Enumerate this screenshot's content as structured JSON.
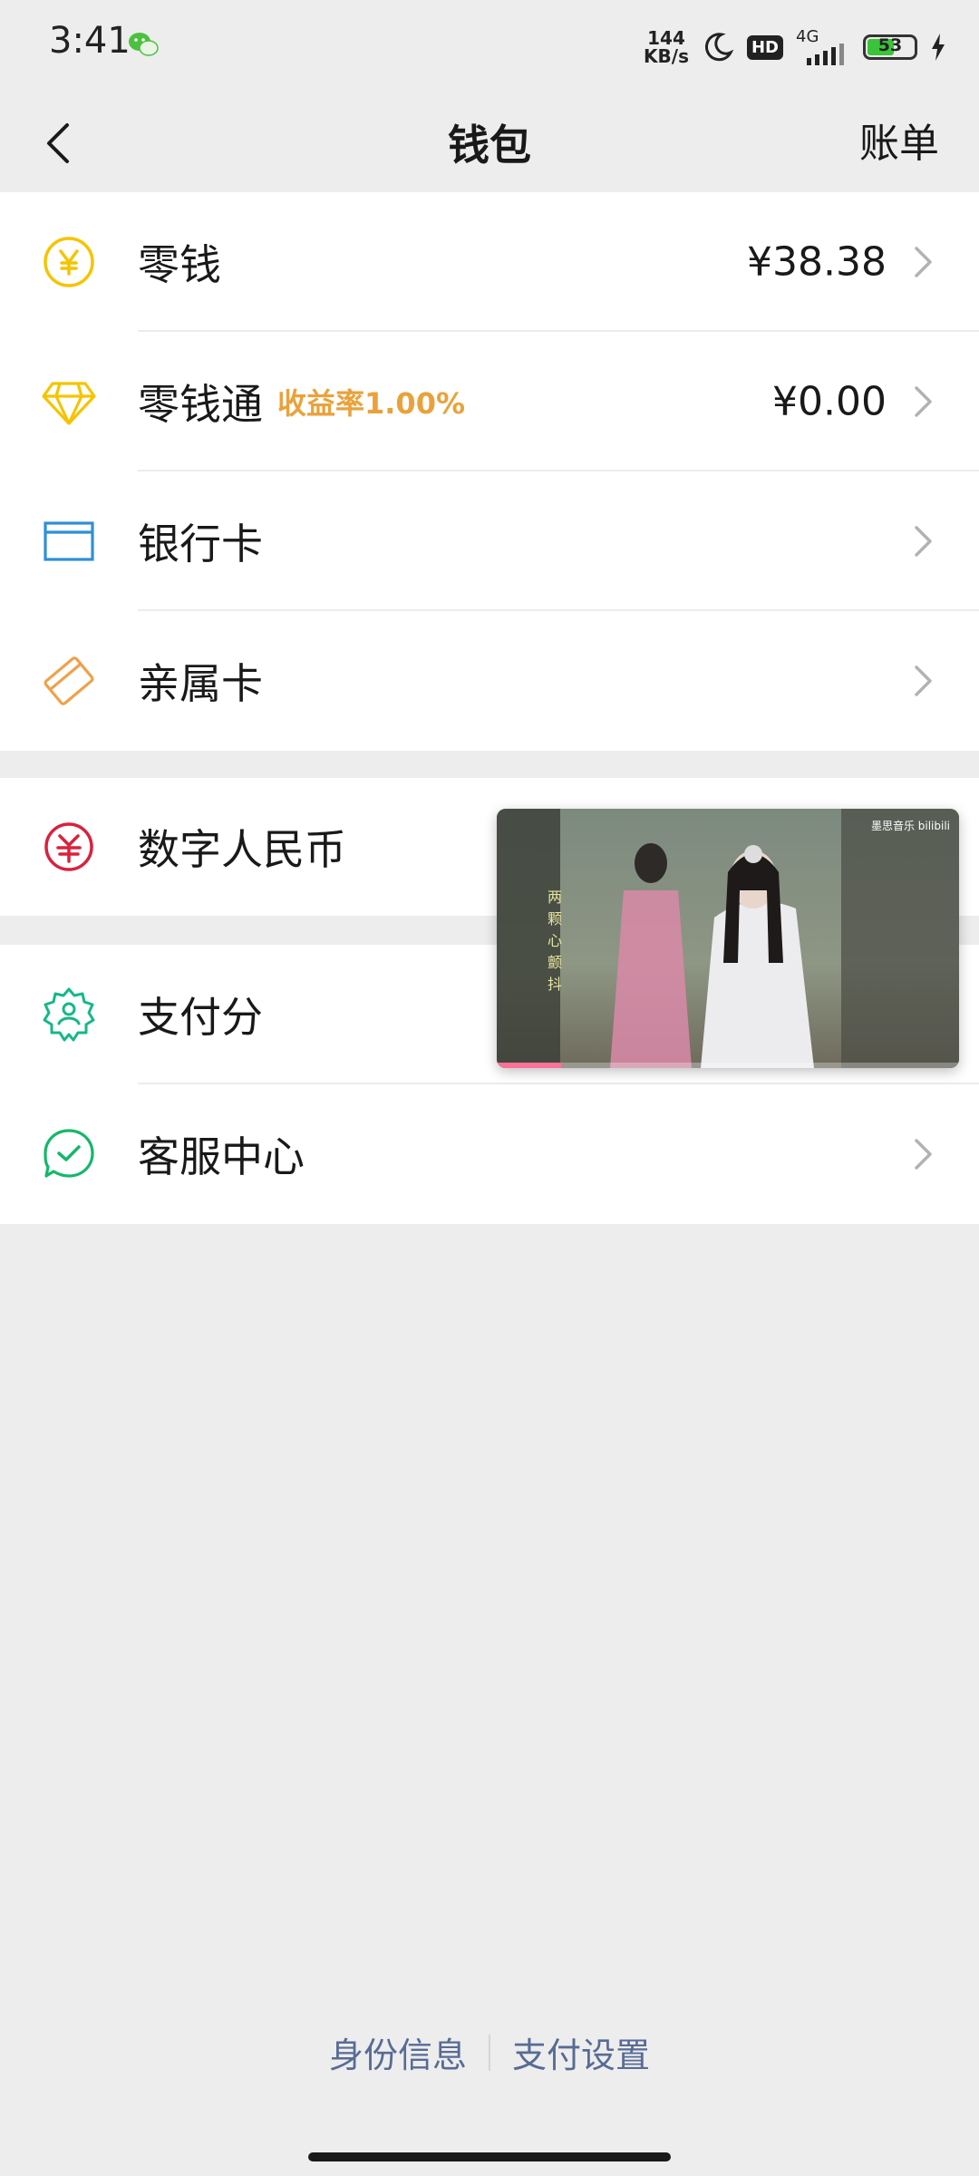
{
  "status_bar": {
    "time": "3:41",
    "net_speed_value": "144",
    "net_speed_unit": "KB/s",
    "hd_label": "HD",
    "network_label": "4G",
    "battery": "53"
  },
  "header": {
    "title": "钱包",
    "bill_label": "账单"
  },
  "wallet_items": [
    {
      "label": "零钱",
      "value": "¥38.38",
      "icon": "yuan-coin-icon",
      "color": "#f5c400"
    },
    {
      "label": "零钱通",
      "tag": "收益率1.00%",
      "value": "¥0.00",
      "icon": "diamond-icon",
      "color": "#f5c400"
    },
    {
      "label": "银行卡",
      "icon": "bank-card-icon",
      "color": "#2f8fd8"
    },
    {
      "label": "亲属卡",
      "icon": "family-card-icon",
      "color": "#f0a14a"
    }
  ],
  "services": [
    {
      "label": "数字人民币",
      "icon": "digital-rmb-icon",
      "color": "#d9213d"
    },
    {
      "label": "支付分",
      "icon": "pay-score-icon",
      "color": "#16b78a"
    },
    {
      "label": "客服中心",
      "icon": "customer-service-icon",
      "color": "#16b76a"
    }
  ],
  "video_overlay": {
    "watermark": "墨思音乐 bilibili",
    "subtitle": "两颗心颤抖",
    "progress": 0.14
  },
  "footer": {
    "identity_label": "身份信息",
    "pay_settings_label": "支付设置"
  }
}
